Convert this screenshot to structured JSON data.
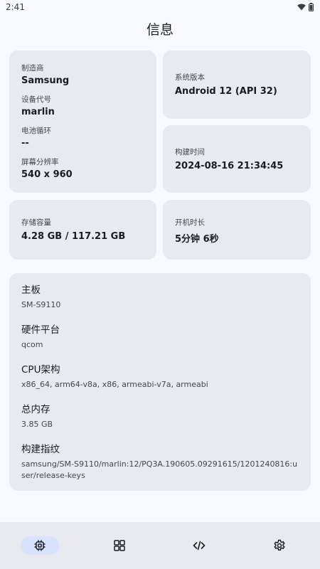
{
  "status_bar": {
    "time": "2:41",
    "icons": [
      "wifi-icon",
      "battery-icon"
    ]
  },
  "app_bar": {
    "title": "信息"
  },
  "device_card": {
    "manufacturer_label": "制造商",
    "manufacturer": "Samsung",
    "codename_label": "设备代号",
    "codename": "marlin",
    "battery_cycles_label": "电池循环",
    "battery_cycles": "--",
    "resolution_label": "屏幕分辨率",
    "resolution": "540 x 960"
  },
  "system_card": {
    "label": "系统版本",
    "value": "Android 12 (API 32)"
  },
  "build_time_card": {
    "label": "构建时间",
    "value": "2024-08-16 21:34:45"
  },
  "storage_card": {
    "label": "存储容量",
    "value": "4.28 GB / 117.21 GB"
  },
  "uptime_card": {
    "label": "开机时长",
    "value": "5分钟 6秒"
  },
  "details": [
    {
      "title": "主板",
      "value": "SM-S9110"
    },
    {
      "title": "硬件平台",
      "value": "qcom"
    },
    {
      "title": "CPU架构",
      "value": "x86_64, arm64-v8a, x86, armeabi-v7a, armeabi"
    },
    {
      "title": "总内存",
      "value": "3.85 GB"
    },
    {
      "title": "构建指纹",
      "value": "samsung/SM-S9110/marlin:12/PQ3A.190605.09291615/1201240816:user/release-keys"
    }
  ],
  "nav": {
    "items": [
      "chip-icon",
      "grid-icon",
      "code-icon",
      "settings-icon"
    ],
    "active_index": 0,
    "active_color": "#d7e2ff",
    "icon_color": "#1b1c20"
  }
}
